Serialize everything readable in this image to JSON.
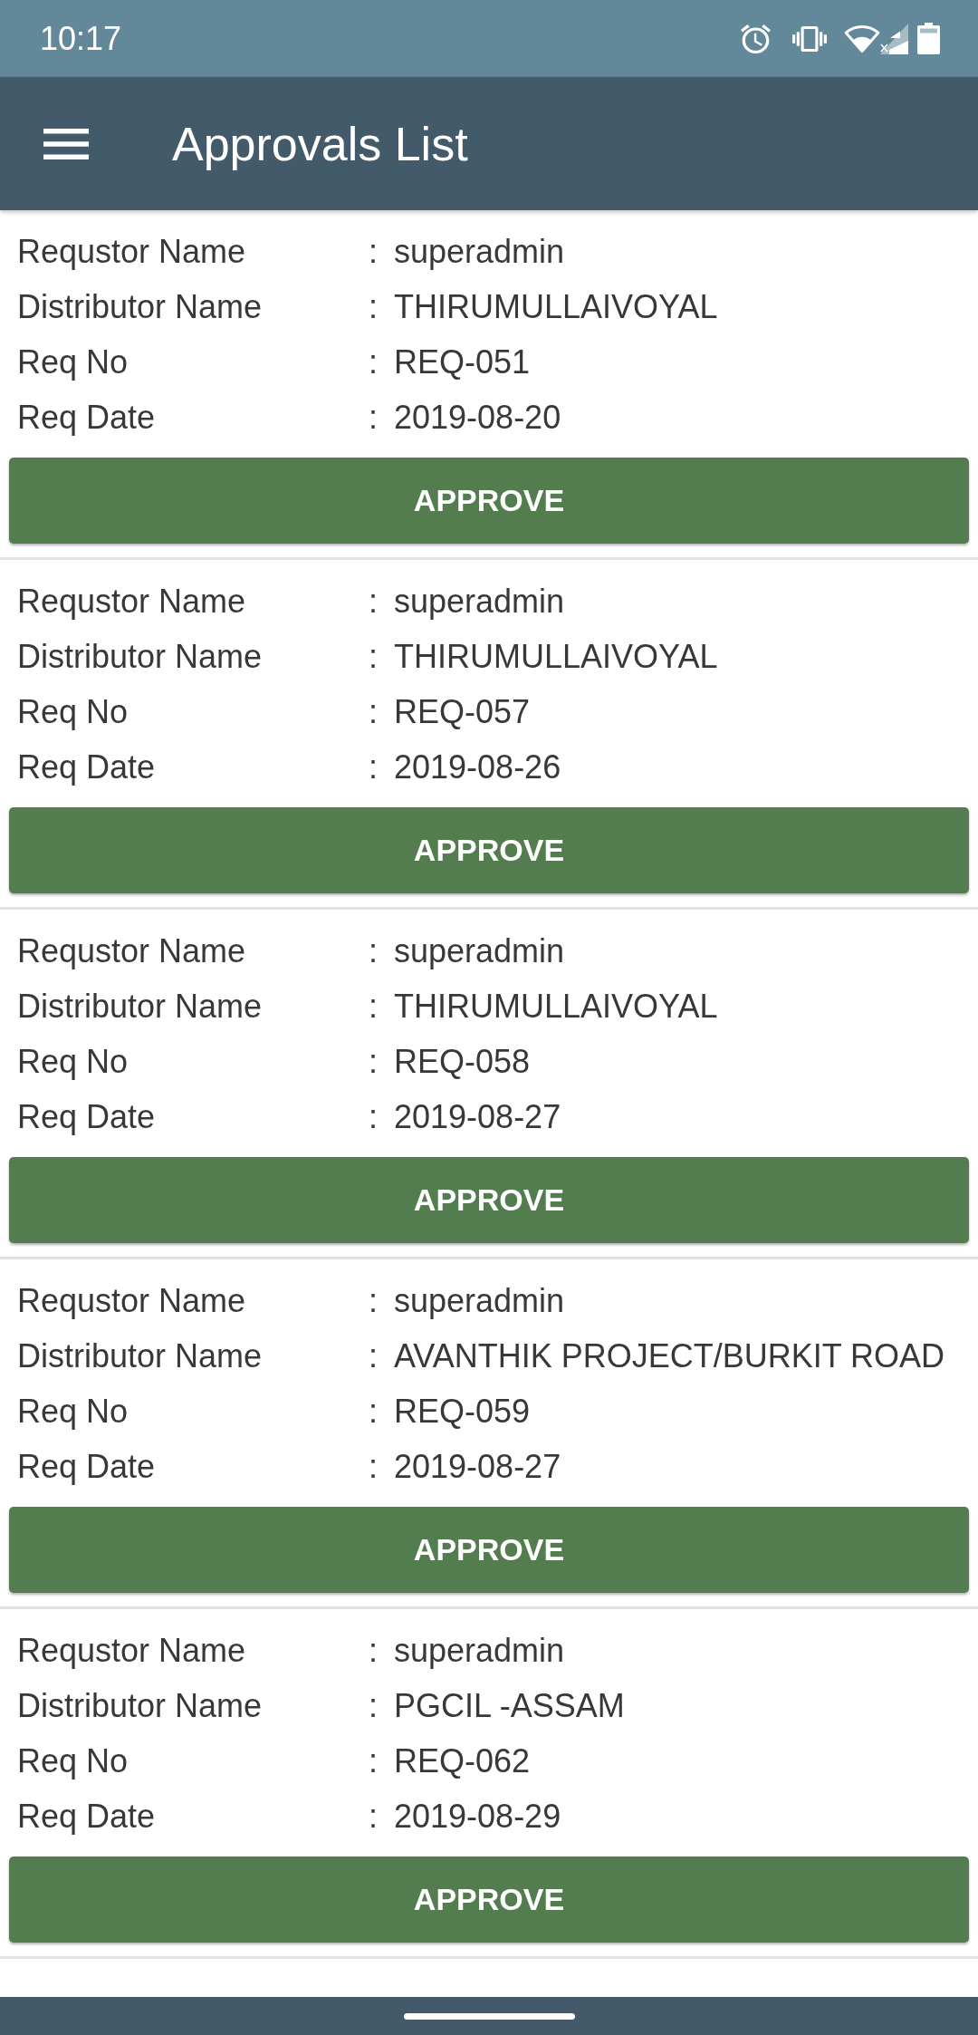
{
  "status_bar": {
    "time": "10:17"
  },
  "app_bar": {
    "title": "Approvals List"
  },
  "approvals": [
    {
      "fields": [
        {
          "label": "Requstor Name",
          "separator": ":",
          "value": "superadmin"
        },
        {
          "label": "Distributor Name",
          "separator": ":",
          "value": "THIRUMULLAIVOYAL"
        },
        {
          "label": "Req No",
          "separator": ":",
          "value": "REQ-051"
        },
        {
          "label": "Req Date",
          "separator": ":",
          "value": "2019-08-20"
        }
      ],
      "button": "APPROVE"
    },
    {
      "fields": [
        {
          "label": "Requstor Name",
          "separator": ":",
          "value": "superadmin"
        },
        {
          "label": "Distributor Name",
          "separator": ":",
          "value": "THIRUMULLAIVOYAL"
        },
        {
          "label": "Req No",
          "separator": ":",
          "value": "REQ-057"
        },
        {
          "label": "Req Date",
          "separator": ":",
          "value": "2019-08-26"
        }
      ],
      "button": "APPROVE"
    },
    {
      "fields": [
        {
          "label": "Requstor Name",
          "separator": ":",
          "value": "superadmin"
        },
        {
          "label": "Distributor Name",
          "separator": ":",
          "value": "THIRUMULLAIVOYAL"
        },
        {
          "label": "Req No",
          "separator": ":",
          "value": "REQ-058"
        },
        {
          "label": "Req Date",
          "separator": ":",
          "value": "2019-08-27"
        }
      ],
      "button": "APPROVE"
    },
    {
      "fields": [
        {
          "label": "Requstor Name",
          "separator": ":",
          "value": "superadmin"
        },
        {
          "label": "Distributor Name",
          "separator": ":",
          "value": "AVANTHIK PROJECT/BURKIT ROAD"
        },
        {
          "label": "Req No",
          "separator": ":",
          "value": "REQ-059"
        },
        {
          "label": "Req Date",
          "separator": ":",
          "value": "2019-08-27"
        }
      ],
      "button": "APPROVE"
    },
    {
      "fields": [
        {
          "label": "Requstor Name",
          "separator": ":",
          "value": "superadmin"
        },
        {
          "label": "Distributor Name",
          "separator": ":",
          "value": "PGCIL -ASSAM"
        },
        {
          "label": "Req No",
          "separator": ":",
          "value": "REQ-062"
        },
        {
          "label": "Req Date",
          "separator": ":",
          "value": "2019-08-29"
        }
      ],
      "button": "APPROVE"
    }
  ]
}
